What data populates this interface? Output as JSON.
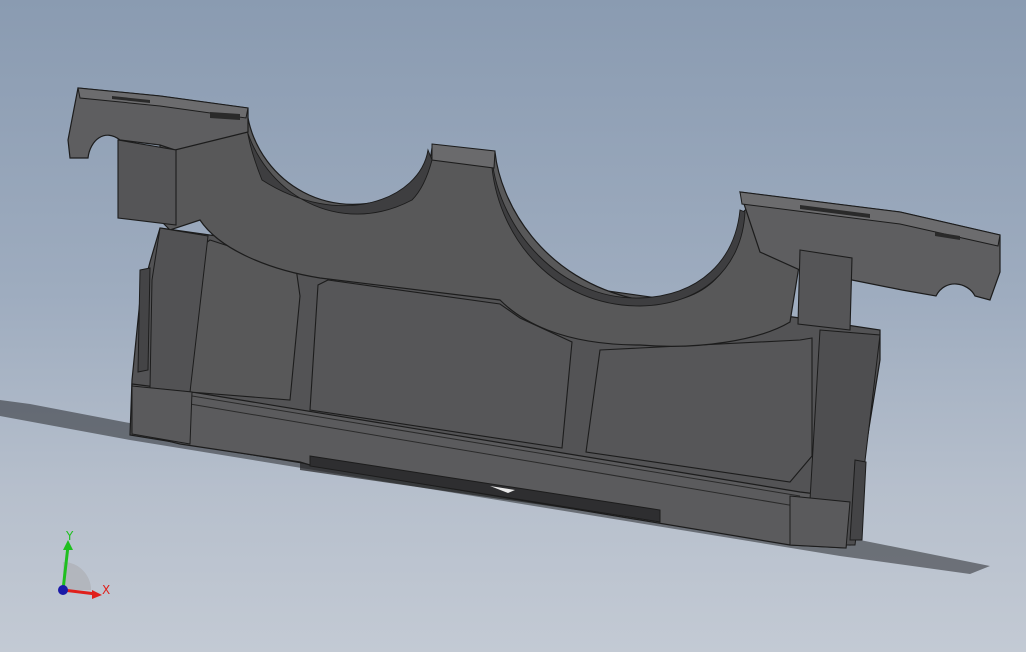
{
  "viewport": {
    "background_top": "#8a9bb1",
    "background_bottom": "#c3cad4",
    "model_color": "#4f4f51",
    "model_edge_color": "#1c1c1c",
    "model_highlight": "#6a6a6c"
  },
  "triad": {
    "x_label": "X",
    "y_label": "Y",
    "x_color": "#e0201c",
    "y_color": "#1fbf1f",
    "z_color": "#1a1aa8"
  }
}
